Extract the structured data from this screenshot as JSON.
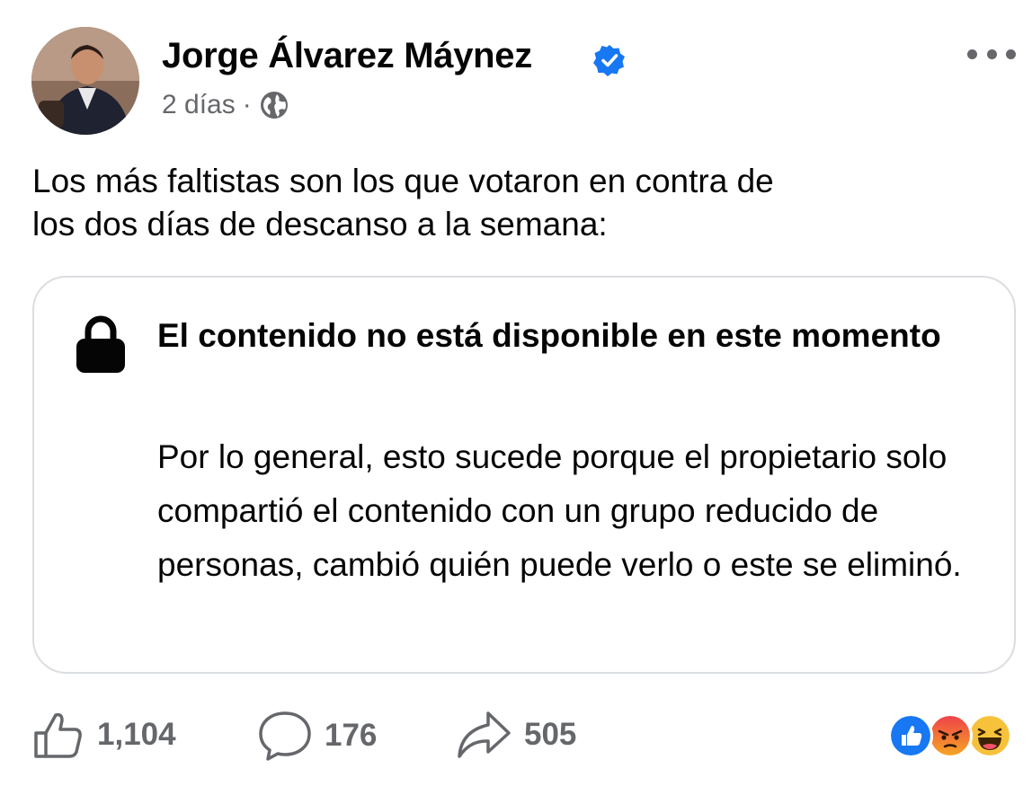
{
  "post": {
    "author": "Jorge Álvarez Máynez",
    "timestamp": "2 días",
    "separator": "·",
    "text_line1": "Los más faltistas son los que votaron en contra de",
    "text_line2": "los dos días de descanso a la semana:"
  },
  "unavailable": {
    "title": "El contenido no está disponible en este momento",
    "body": "Por lo general, esto sucede porque el propietario solo compartió el contenido con un grupo reducido de personas, cambió quién puede verlo o este se eliminó."
  },
  "footer": {
    "likes": "1,104",
    "comments": "176",
    "shares": "505"
  },
  "icons": [
    "verified-badge-icon",
    "globe-icon",
    "more-icon",
    "lock-icon",
    "like-icon",
    "comment-icon",
    "share-icon",
    "like-reaction-icon",
    "angry-reaction-icon",
    "haha-reaction-icon"
  ],
  "colors": {
    "verified": "#1877f2",
    "secondary_text": "#65676b",
    "border": "#dadde1"
  }
}
